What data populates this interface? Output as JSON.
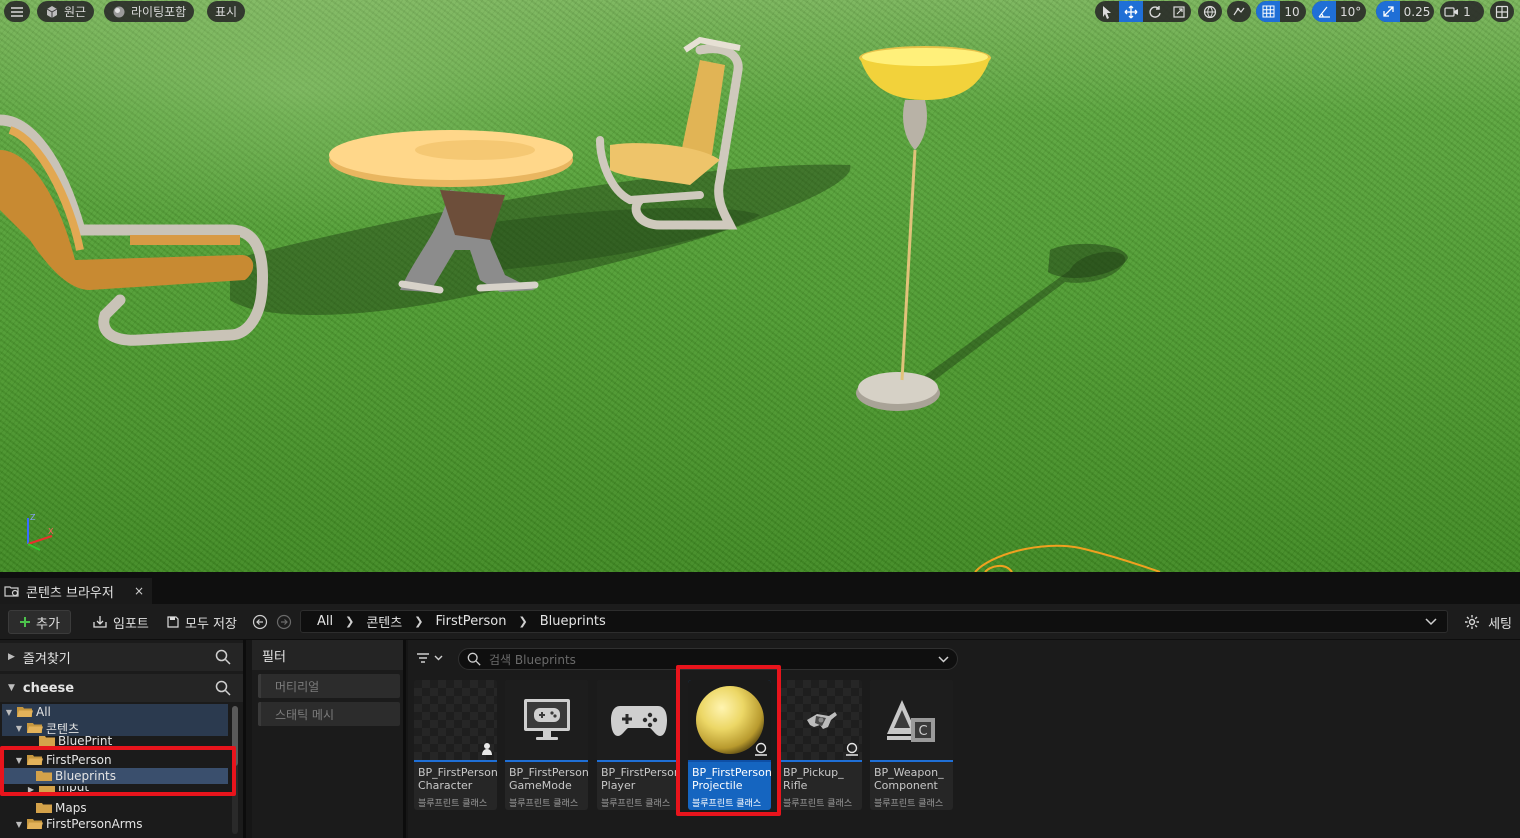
{
  "viewport": {
    "menu_icon": "hamburger-icon",
    "perspective_label": "원근",
    "lighting_label": "라이팅포함",
    "show_label": "표시",
    "grid_snap_value": "10",
    "rotation_snap_value": "10°",
    "scale_snap_value": "0.25",
    "camera_speed_value": "1"
  },
  "content_browser": {
    "tab_title": "콘텐츠 브라우저",
    "close_glyph": "×",
    "toolbar": {
      "add_label": "추가",
      "import_label": "임포트",
      "save_all_label": "모두 저장",
      "settings_label": "세팅"
    },
    "breadcrumbs": [
      "All",
      "콘텐츠",
      "FirstPerson",
      "Blueprints"
    ],
    "favorites_label": "즐겨찾기",
    "project_label": "cheese",
    "tree": [
      {
        "label": "All",
        "depth": 0,
        "expanded": true
      },
      {
        "label": "콘텐츠",
        "depth": 1,
        "expanded": true
      },
      {
        "label": "BluePrint",
        "depth": 2,
        "expanded": false
      },
      {
        "label": "FirstPerson",
        "depth": 1,
        "expanded": true
      },
      {
        "label": "Blueprints",
        "depth": 2,
        "expanded": false
      },
      {
        "label": "Input",
        "depth": 2,
        "expanded": false
      },
      {
        "label": "Maps",
        "depth": 2,
        "expanded": false
      },
      {
        "label": "FirstPersonArms",
        "depth": 1,
        "expanded": true
      }
    ],
    "filter_title": "필터",
    "filters": [
      "머티리얼",
      "스태틱 메시"
    ],
    "search_placeholder": "검색 Blueprints",
    "assets": [
      {
        "name": "BP_FirstPerson\nCharacter",
        "type": "블루프린트 클래스",
        "icon": "character-icon",
        "selected": false
      },
      {
        "name": "BP_FirstPerson\nGameMode",
        "type": "블루프린트 클래스",
        "icon": "monitor-gamepad-icon",
        "selected": false
      },
      {
        "name": "BP_FirstPerson\nPlayer",
        "type": "블루프린트 클래스",
        "icon": "gamepad-icon",
        "selected": false
      },
      {
        "name": "BP_FirstPerson\nProjectile",
        "type": "블루프린트 클래스",
        "icon": "sphere-icon",
        "selected": true
      },
      {
        "name": "BP_Pickup_\nRifle",
        "type": "블루프린트 클래스",
        "icon": "rifle-icon",
        "selected": false
      },
      {
        "name": "BP_Weapon_\nComponent",
        "type": "블루프린트 클래스",
        "icon": "component-icon",
        "selected": false
      }
    ]
  }
}
